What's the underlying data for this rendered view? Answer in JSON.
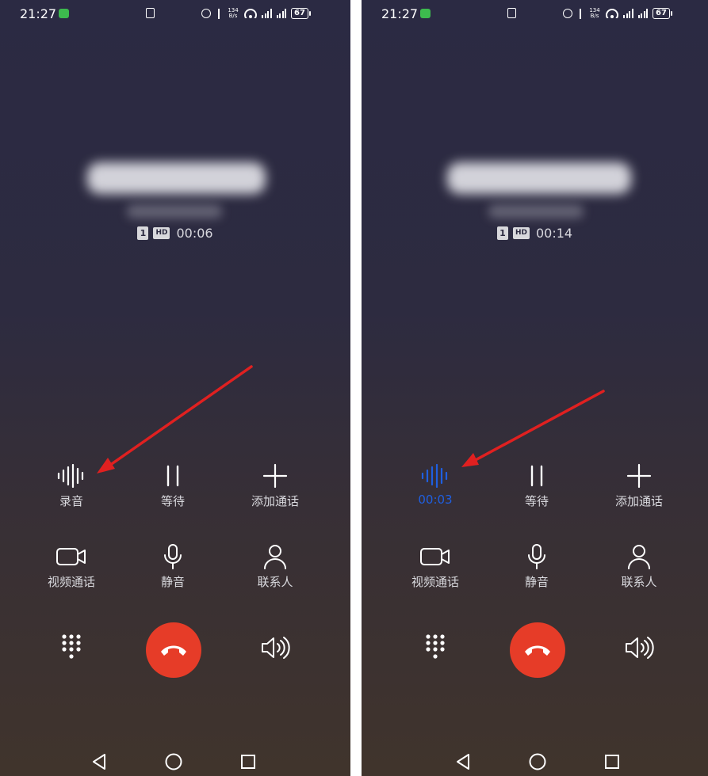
{
  "colors": {
    "end_call": "#e63c28",
    "recording_active": "#1f5fe0",
    "arrow": "#e02020",
    "wifi_call_indicator": "#3dba4e"
  },
  "left": {
    "status": {
      "time": "21:27",
      "net_speed_value": "134",
      "net_speed_unit": "B/s",
      "battery": "67"
    },
    "call": {
      "sim": "1",
      "hd": "HD",
      "duration": "00:06"
    },
    "buttons": {
      "record": "录音",
      "hold": "等待",
      "add_call": "添加通话",
      "video_call": "视频通话",
      "mute": "静音",
      "contacts": "联系人"
    }
  },
  "right": {
    "status": {
      "time": "21:27",
      "net_speed_value": "134",
      "net_speed_unit": "B/s",
      "battery": "67"
    },
    "call": {
      "sim": "1",
      "hd": "HD",
      "duration": "00:14"
    },
    "buttons": {
      "record": "00:03",
      "hold": "等待",
      "add_call": "添加通话",
      "video_call": "视频通话",
      "mute": "静音",
      "contacts": "联系人"
    }
  }
}
